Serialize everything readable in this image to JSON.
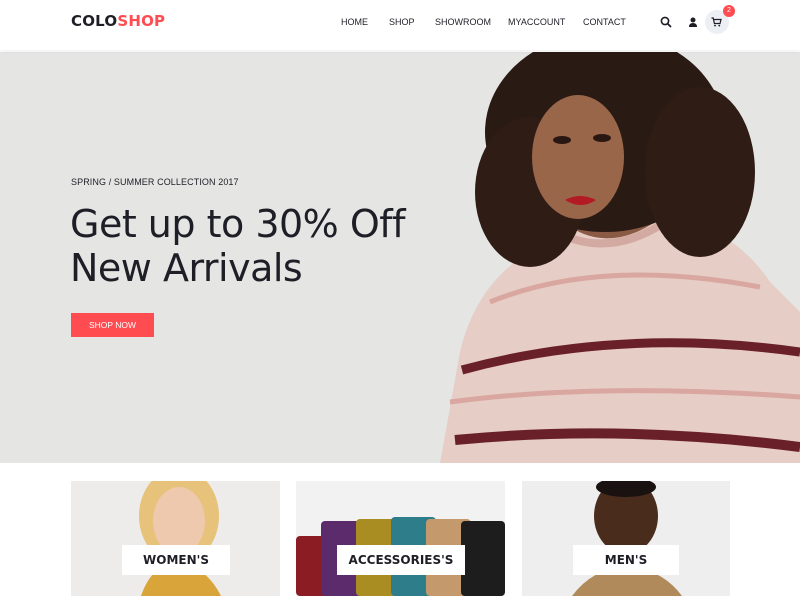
{
  "brand": {
    "part1": "COLO",
    "part2": "SHOP",
    "accent": "#fe4c50"
  },
  "nav": {
    "items": [
      "HOME",
      "SHOP",
      "SHOWROOM",
      "MYACCOUNT",
      "CONTACT"
    ]
  },
  "header_icons": [
    "search-icon",
    "user-icon",
    "cart-icon"
  ],
  "cart": {
    "count": "2"
  },
  "hero": {
    "subtitle": "SPRING / SUMMER COLLECTION 2017",
    "title_line1": "Get up to 30% Off",
    "title_line2": "New Arrivals",
    "button": "SHOP NOW"
  },
  "banners": [
    {
      "label": "WOMEN'S"
    },
    {
      "label": "ACCESSORIES'S"
    },
    {
      "label": "MEN'S"
    }
  ]
}
